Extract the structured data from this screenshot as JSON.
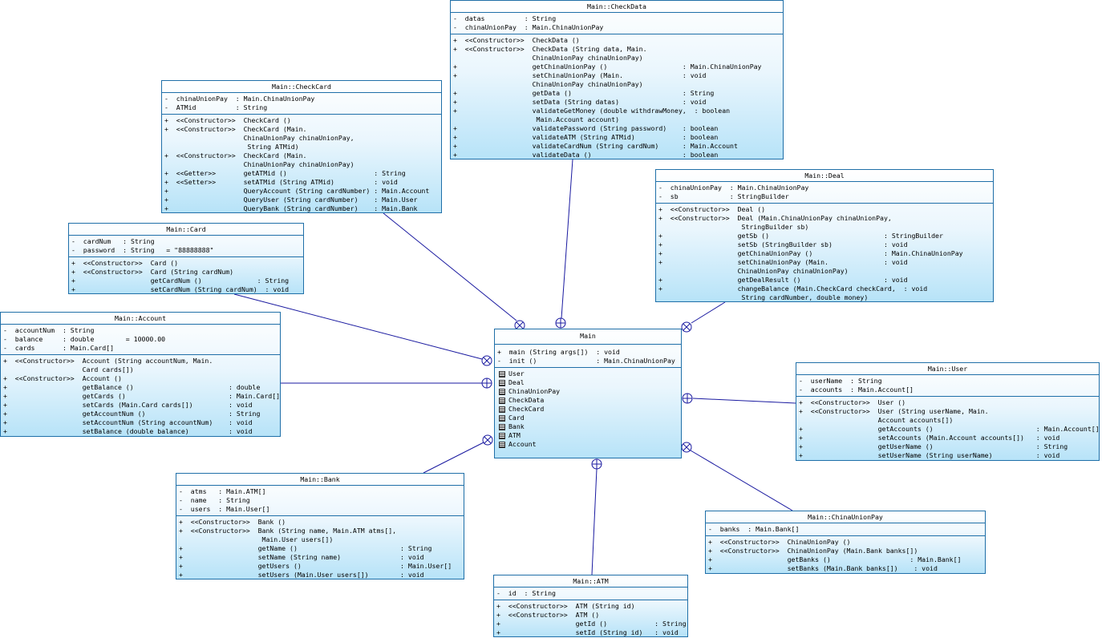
{
  "diagram": {
    "classes": {
      "checkdata": {
        "title": "Main::CheckData",
        "attributes": [
          "-  datas          : String",
          "-  chinaUnionPay  : Main.ChinaUnionPay"
        ],
        "operations": [
          "+  <<Constructor>>  CheckData ()",
          "+  <<Constructor>>  CheckData (String data, Main.",
          "                    ChinaUnionPay chinaUnionPay)",
          "+                   getChinaUnionPay ()                   : Main.ChinaUnionPay",
          "+                   setChinaUnionPay (Main.               : void",
          "                    ChinaUnionPay chinaUnionPay)",
          "+                   getData ()                            : String",
          "+                   setData (String datas)                : void",
          "+                   validateGetMoney (double withdrawMoney,  : boolean",
          "                     Main.Account account)",
          "+                   validatePassword (String password)    : boolean",
          "+                   validateATM (String ATMid)            : boolean",
          "+                   validateCardNum (String cardNum)      : Main.Account",
          "+                   validateData ()                       : boolean"
        ]
      },
      "checkcard": {
        "title": "Main::CheckCard",
        "attributes": [
          "-  chinaUnionPay  : Main.ChinaUnionPay",
          "-  ATMid          : String"
        ],
        "operations": [
          "+  <<Constructor>>  CheckCard ()",
          "+  <<Constructor>>  CheckCard (Main.",
          "                    ChinaUnionPay chinaUnionPay,",
          "                     String ATMid)",
          "+  <<Constructor>>  CheckCard (Main.",
          "                    ChinaUnionPay chinaUnionPay)",
          "+  <<Getter>>       getATMid ()                      : String",
          "+  <<Setter>>       setATMid (String ATMid)          : void",
          "+                   QueryAccount (String cardNumber) : Main.Account",
          "+                   QueryUser (String cardNumber)    : Main.User",
          "+                   QueryBank (String cardNumber)    : Main.Bank"
        ]
      },
      "deal": {
        "title": "Main::Deal",
        "attributes": [
          "-  chinaUnionPay  : Main.ChinaUnionPay",
          "-  sb             : StringBuilder"
        ],
        "operations": [
          "+  <<Constructor>>  Deal ()",
          "+  <<Constructor>>  Deal (Main.ChinaUnionPay chinaUnionPay,",
          "                     StringBuilder sb)",
          "+                   getSb ()                             : StringBuilder",
          "+                   setSb (StringBuilder sb)             : void",
          "+                   getChinaUnionPay ()                  : Main.ChinaUnionPay",
          "+                   setChinaUnionPay (Main.              : void",
          "                    ChinaUnionPay chinaUnionPay)",
          "+                   getDealResult ()                     : void",
          "+                   changeBalance (Main.CheckCard checkCard,  : void",
          "                     String cardNumber, double money)"
        ]
      },
      "card": {
        "title": "Main::Card",
        "attributes": [
          "-  cardNum   : String",
          "-  password  : String   = \"88888888\""
        ],
        "operations": [
          "+  <<Constructor>>  Card ()",
          "+  <<Constructor>>  Card (String cardNum)",
          "+                   getCardNum ()              : String",
          "+                   setCardNum (String cardNum)  : void"
        ]
      },
      "account": {
        "title": "Main::Account",
        "attributes": [
          "-  accountNum  : String",
          "-  balance     : double        = 10000.00",
          "-  cards       : Main.Card[]"
        ],
        "operations": [
          "+  <<Constructor>>  Account (String accountNum, Main.",
          "                    Card cards[])",
          "+  <<Constructor>>  Account ()",
          "+                   getBalance ()                        : double",
          "+                   getCards ()                          : Main.Card[]",
          "+                   setCards (Main.Card cards[])         : void",
          "+                   getAccountNum ()                     : String",
          "+                   setAccountNum (String accountNum)    : void",
          "+                   setBalance (double balance)          : void"
        ]
      },
      "main": {
        "title": "Main",
        "operations": [
          "+  main (String args[])  : void",
          "-  init ()               : Main.ChinaUnionPay"
        ],
        "nested": [
          "User",
          "Deal",
          "ChinaUnionPay",
          "CheckData",
          "CheckCard",
          "Card",
          "Bank",
          "ATM",
          "Account"
        ]
      },
      "user": {
        "title": "Main::User",
        "attributes": [
          "-  userName  : String",
          "-  accounts  : Main.Account[]"
        ],
        "operations": [
          "+  <<Constructor>>  User ()",
          "+  <<Constructor>>  User (String userName, Main.",
          "                    Account accounts[])",
          "+                   getAccounts ()                          : Main.Account[]",
          "+                   setAccounts (Main.Account accounts[])   : void",
          "+                   getUserName ()                          : String",
          "+                   setUserName (String userName)           : void"
        ]
      },
      "bank": {
        "title": "Main::Bank",
        "attributes": [
          "-  atms   : Main.ATM[]",
          "-  name   : String",
          "-  users  : Main.User[]"
        ],
        "operations": [
          "+  <<Constructor>>  Bank ()",
          "+  <<Constructor>>  Bank (String name, Main.ATM atms[],",
          "                     Main.User users[])",
          "+                   getName ()                          : String",
          "+                   setName (String name)               : void",
          "+                   getUsers ()                         : Main.User[]",
          "+                   setUsers (Main.User users[])        : void"
        ]
      },
      "chinaunionpay": {
        "title": "Main::ChinaUnionPay",
        "attributes": [
          "-  banks  : Main.Bank[]"
        ],
        "operations": [
          "+  <<Constructor>>  ChinaUnionPay ()",
          "+  <<Constructor>>  ChinaUnionPay (Main.Bank banks[])",
          "+                   getBanks ()                    : Main.Bank[]",
          "+                   setBanks (Main.Bank banks[])    : void"
        ]
      },
      "atm": {
        "title": "Main::ATM",
        "attributes": [
          "-  id  : String"
        ],
        "operations": [
          "+  <<Constructor>>  ATM (String id)",
          "+  <<Constructor>>  ATM ()",
          "+                   getId ()            : String",
          "+                   setId (String id)   : void"
        ]
      }
    },
    "colors": {
      "border": "#1f6fa8",
      "line": "#1a1aa0",
      "fill_top": "#ffffff",
      "fill_bottom": "#b7e3f8"
    }
  }
}
